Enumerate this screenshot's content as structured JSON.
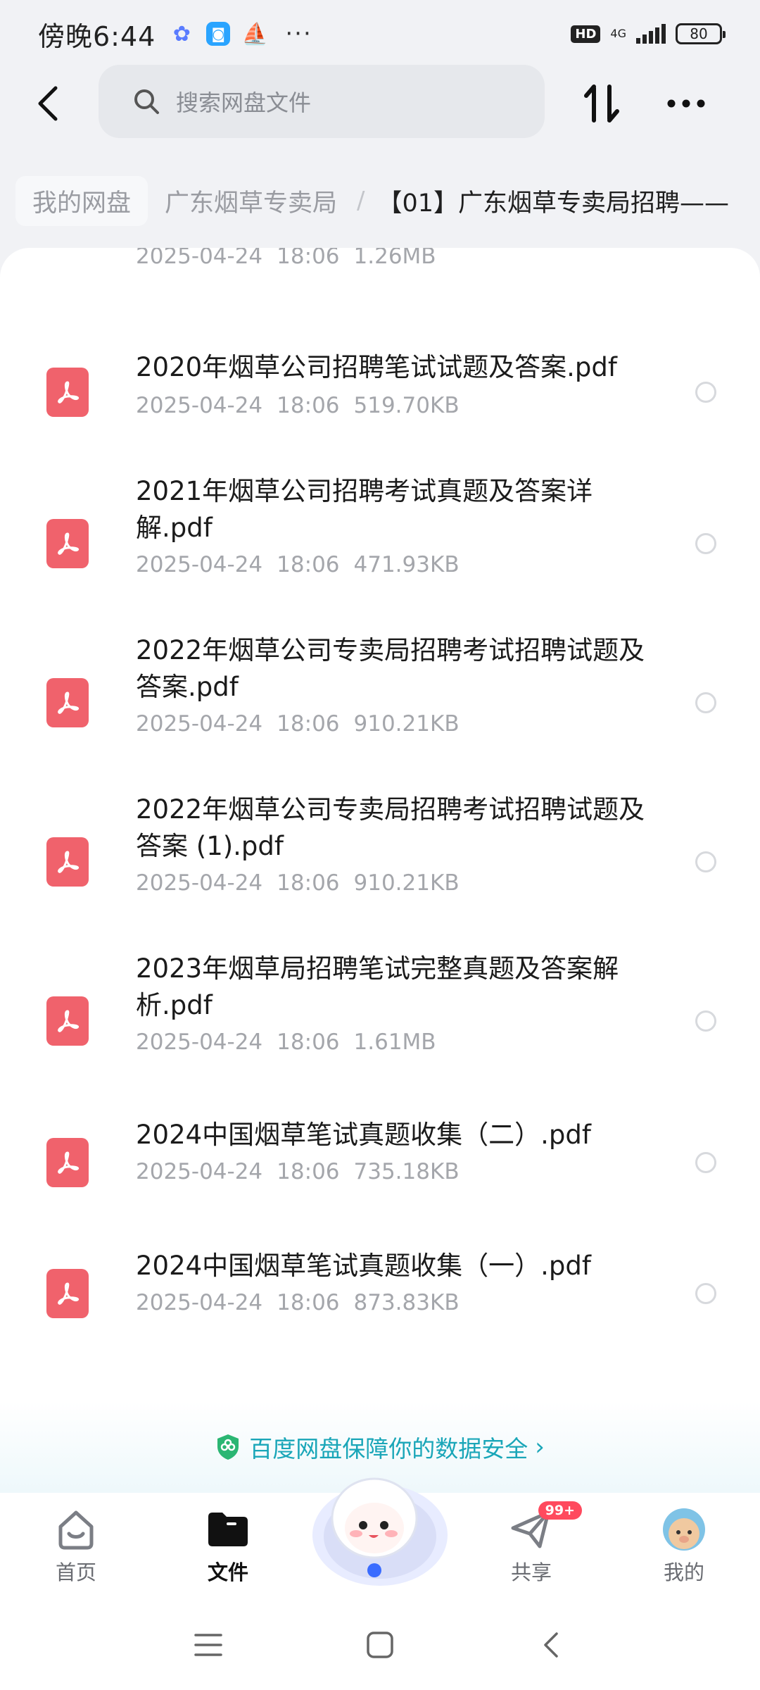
{
  "status_bar": {
    "time": "傍晚6:44",
    "apps": [
      "baidu-netdisk-app-icon",
      "blue-app-icon",
      "sailboat-app-icon"
    ],
    "more": "···",
    "hd": "HD",
    "network": "4G",
    "battery": "80"
  },
  "toolbar": {
    "search_placeholder": "搜索网盘文件"
  },
  "breadcrumb": {
    "items": [
      "我的网盘",
      "广东烟草专卖局",
      "【01】广东烟草专卖局招聘——"
    ]
  },
  "files": [
    {
      "name": "",
      "date": "2025-04-24",
      "time": "18:06",
      "size": "1.26MB"
    },
    {
      "name": "2020年烟草公司招聘笔试试题及答案.pdf",
      "date": "2025-04-24",
      "time": "18:06",
      "size": "519.70KB"
    },
    {
      "name": "2021年烟草公司招聘考试真题及答案详解.pdf",
      "date": "2025-04-24",
      "time": "18:06",
      "size": "471.93KB"
    },
    {
      "name": "2022年烟草公司专卖局招聘考试招聘试题及答案.pdf",
      "date": "2025-04-24",
      "time": "18:06",
      "size": "910.21KB"
    },
    {
      "name": "2022年烟草公司专卖局招聘考试招聘试题及答案 (1).pdf",
      "date": "2025-04-24",
      "time": "18:06",
      "size": "910.21KB"
    },
    {
      "name": "2023年烟草局招聘笔试完整真题及答案解析.pdf",
      "date": "2025-04-24",
      "time": "18:06",
      "size": "1.61MB"
    },
    {
      "name": "2024中国烟草笔试真题收集（二）.pdf",
      "date": "2025-04-24",
      "time": "18:06",
      "size": "735.18KB"
    },
    {
      "name": "2024中国烟草笔试真题收集（一）.pdf",
      "date": "2025-04-24",
      "time": "18:06",
      "size": "873.83KB"
    }
  ],
  "safety_banner": {
    "text": "百度网盘保障你的数据安全"
  },
  "bottom_nav": {
    "home": "首页",
    "files": "文件",
    "share": "共享",
    "share_badge": "99+",
    "me": "我的"
  },
  "colors": {
    "pdf_red": "#f0626c",
    "accent_teal": "#1aa6b8",
    "badge_red": "#ff4a5e"
  }
}
